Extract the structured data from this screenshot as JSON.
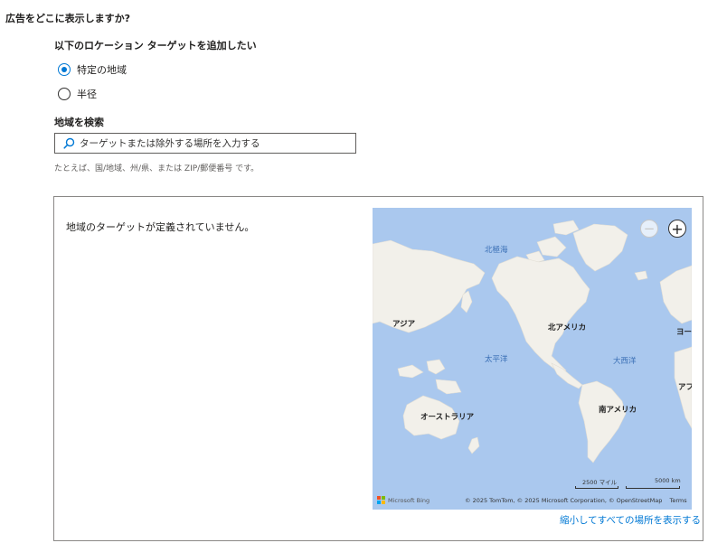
{
  "page": {
    "title": "広告をどこに表示しますか?"
  },
  "location": {
    "section_label": "以下のロケーション ターゲットを追加したい",
    "options": [
      {
        "label": "特定の地域",
        "selected": true
      },
      {
        "label": "半径",
        "selected": false
      }
    ]
  },
  "search": {
    "label": "地域を検索",
    "placeholder": "ターゲットまたは除外する場所を入力する",
    "value": "",
    "hint": "たとえば、国/地域、州/県、または ZIP/郵便番号 です。",
    "icon": "search-icon"
  },
  "map_panel": {
    "empty_message": "地域のターゲットが定義されていません。",
    "zoom_out_symbol": "−",
    "zoom_in_symbol": "+",
    "labels": {
      "arctic": "北極海",
      "asia": "アジア",
      "north_america": "北アメリカ",
      "europe": "ヨー",
      "pacific": "太平洋",
      "atlantic": "大西洋",
      "africa": "アフ",
      "australia": "オーストラリア",
      "south_america": "南アメリカ"
    },
    "scale": {
      "miles": "2500 マイル",
      "km": "5000 km"
    },
    "logo_text": "Microsoft Bing",
    "attribution": "© 2025 TomTom, © 2025 Microsoft Corporation, © OpenStreetMap",
    "terms": "Terms",
    "zoom_all_link": "縮小してすべての場所を表示する"
  },
  "colors": {
    "accent": "#0078d4",
    "ocean": "#aac8ee",
    "land": "#f2f0ea"
  }
}
